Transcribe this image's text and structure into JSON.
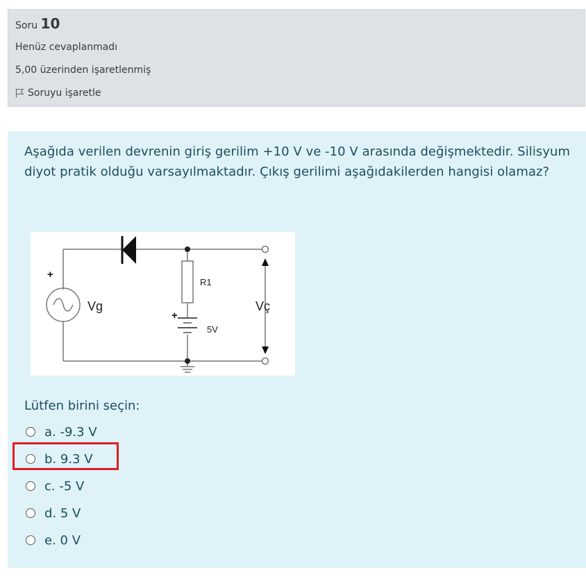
{
  "info": {
    "question_label": "Soru",
    "question_number": "10",
    "state": "Henüz cevaplanmadı",
    "grade": "5,00 üzerinden işaretlenmiş",
    "flag_label": "Soruyu işaretle"
  },
  "question": {
    "text": "Aşağıda verilen devrenin giriş gerilim +10 V ve -10 V arasında değişmektedir. Silisyum diyot pratik olduğu varsayılmaktadır. Çıkış gerilimi aşağıdakilerden hangisi olamaz?",
    "figure_labels": {
      "source": "Vg",
      "resistor": "R1",
      "battery": "5V",
      "output": "Vç",
      "plus_source": "+",
      "plus_battery": "+"
    },
    "prompt": "Lütfen birini seçin:",
    "options": [
      {
        "label": "a. -9.3 V"
      },
      {
        "label": "b. 9.3 V"
      },
      {
        "label": "c. -5 V"
      },
      {
        "label": "d. 5 V"
      },
      {
        "label": "e. 0 V"
      }
    ]
  },
  "highlight_color": "#e11b22"
}
